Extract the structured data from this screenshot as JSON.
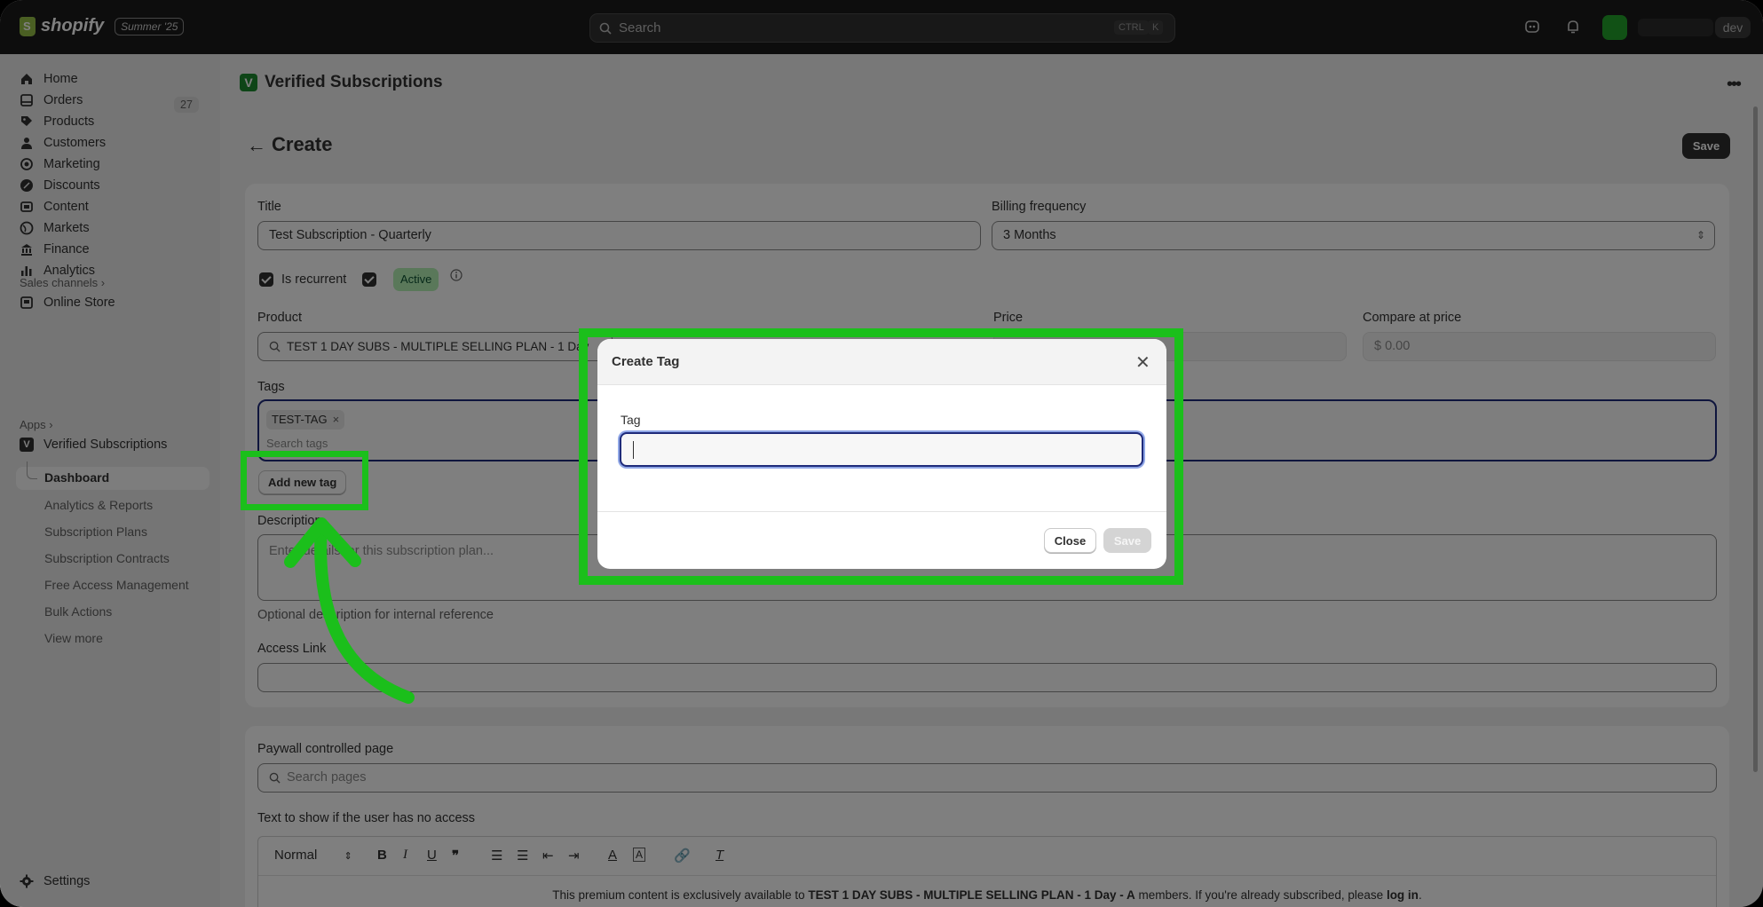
{
  "topbar": {
    "brand": "shopify",
    "edition": "Summer '25",
    "search_placeholder": "Search",
    "kbd_ctrl": "CTRL",
    "kbd_k": "K",
    "store_tag": "dev"
  },
  "sidebar": {
    "items": [
      {
        "label": "Home",
        "icon": "home-icon"
      },
      {
        "label": "Orders",
        "icon": "orders-icon",
        "count": "27"
      },
      {
        "label": "Products",
        "icon": "tag-icon"
      },
      {
        "label": "Customers",
        "icon": "person-icon"
      },
      {
        "label": "Marketing",
        "icon": "target-icon"
      },
      {
        "label": "Discounts",
        "icon": "discount-icon"
      },
      {
        "label": "Content",
        "icon": "content-icon"
      },
      {
        "label": "Markets",
        "icon": "globe-icon"
      },
      {
        "label": "Finance",
        "icon": "bank-icon"
      },
      {
        "label": "Analytics",
        "icon": "chart-icon"
      }
    ],
    "sales_channels_label": "Sales channels",
    "online_store": "Online Store",
    "apps_label": "Apps",
    "app_name": "Verified Subscriptions",
    "app_sub": [
      "Dashboard",
      "Analytics & Reports",
      "Subscription Plans",
      "Subscription Contracts",
      "Free Access Management",
      "Bulk Actions",
      "View more"
    ],
    "settings": "Settings"
  },
  "main": {
    "app_title": "Verified Subscriptions",
    "page_title": "Create",
    "save_label": "Save",
    "title_label": "Title",
    "title_value": "Test Subscription - Quarterly",
    "billing_label": "Billing frequency",
    "billing_value": "3 Months",
    "is_recurrent": "Is recurrent",
    "active_badge": "Active",
    "product_label": "Product",
    "product_value": "TEST 1 DAY SUBS - MULTIPLE SELLING PLAN - 1 Day",
    "price_label": "Price",
    "compare_label": "Compare at price",
    "compare_value": "$ 0.00",
    "tags_label": "Tags",
    "tag_chip": "TEST-TAG",
    "tags_placeholder": "Search tags",
    "add_tag": "Add new tag",
    "description_label": "Description",
    "description_placeholder": "Enter details for this subscription plan...",
    "description_help": "Optional description for internal reference",
    "access_link_label": "Access Link",
    "paywall_label": "Paywall controlled page",
    "paywall_placeholder": "Search pages",
    "no_access_label": "Text to show if the user has no access",
    "editor_format": "Normal",
    "editor_text_pre": "This premium content is exclusively available to ",
    "editor_text_bold": "TEST 1 DAY SUBS - MULTIPLE SELLING PLAN - 1 Day - A",
    "editor_text_mid": " members. If you're already subscribed, please ",
    "editor_text_link": "log in",
    "editor_text_end": "."
  },
  "modal": {
    "title": "Create Tag",
    "tag_label": "Tag",
    "tag_value": "",
    "close_label": "Close",
    "save_label": "Save"
  },
  "colors": {
    "highlight": "#1bbf1b",
    "focus": "#1f2b7a",
    "topbar": "#1a1a1a"
  }
}
